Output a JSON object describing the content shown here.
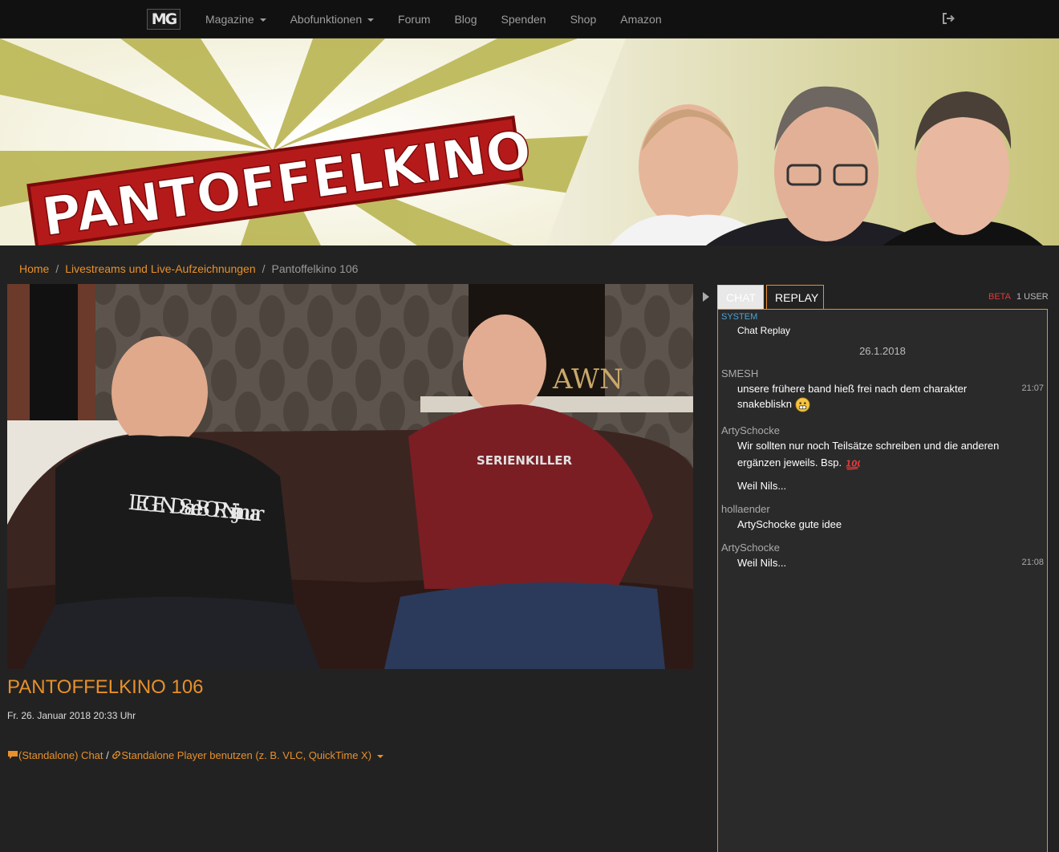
{
  "nav": {
    "logo": "MG",
    "items": [
      {
        "label": "Magazine",
        "dropdown": true
      },
      {
        "label": "Abofunktionen",
        "dropdown": true
      },
      {
        "label": "Forum",
        "dropdown": false
      },
      {
        "label": "Blog",
        "dropdown": false
      },
      {
        "label": "Spenden",
        "dropdown": false
      },
      {
        "label": "Shop",
        "dropdown": false
      },
      {
        "label": "Amazon",
        "dropdown": false
      }
    ],
    "logout_icon": "sign-out-icon"
  },
  "banner": {
    "title": "PANTOFFELKINO"
  },
  "breadcrumb": {
    "home": "Home",
    "section": "Livestreams und Live-Aufzeichnungen",
    "current": "Pantoffelkino 106",
    "separator": "/"
  },
  "video": {
    "title": "PANTOFFELKINO 106",
    "date": "Fr. 26. Januar 2018 20:33 Uhr",
    "shirt_left": "LEGENDS are BORN in januar",
    "shirt_right": "SERIENKILLER",
    "poster": "AWN"
  },
  "links": {
    "chat_label": "(Standalone) Chat",
    "slash": "/",
    "player_label": "Standalone Player benutzen (z. B. VLC, QuickTime X)"
  },
  "chat": {
    "tab_chat": "CHAT",
    "tab_replay": "REPLAY",
    "beta": "BETA",
    "users": "1 USER",
    "system_user": "SYSTEM",
    "system_msg": "Chat Replay",
    "date": "26.1.2018",
    "messages": [
      {
        "user": "SMESH",
        "lines": [
          "unsere frühere band hieß frei nach dem charakter",
          "snakebliskn"
        ],
        "time": "21:07",
        "emoji": "grimace"
      },
      {
        "user": "ArtySchocke",
        "lines": [
          "Wir sollten nur noch Teilsätze schreiben und die anderen",
          "ergänzen jeweils. Bsp.",
          "Weil Nils..."
        ],
        "time": "",
        "emoji": "hundred"
      },
      {
        "user": "hollaender",
        "lines": [
          "ArtySchocke gute idee"
        ],
        "time": ""
      },
      {
        "user": "ArtySchocke",
        "lines": [
          "Weil Nils..."
        ],
        "time": "21:08"
      }
    ]
  },
  "colors": {
    "accent": "#e8902a",
    "background": "#222222",
    "navbar": "#111111",
    "system_user": "#4aa3d9",
    "beta": "#e03a3a"
  }
}
